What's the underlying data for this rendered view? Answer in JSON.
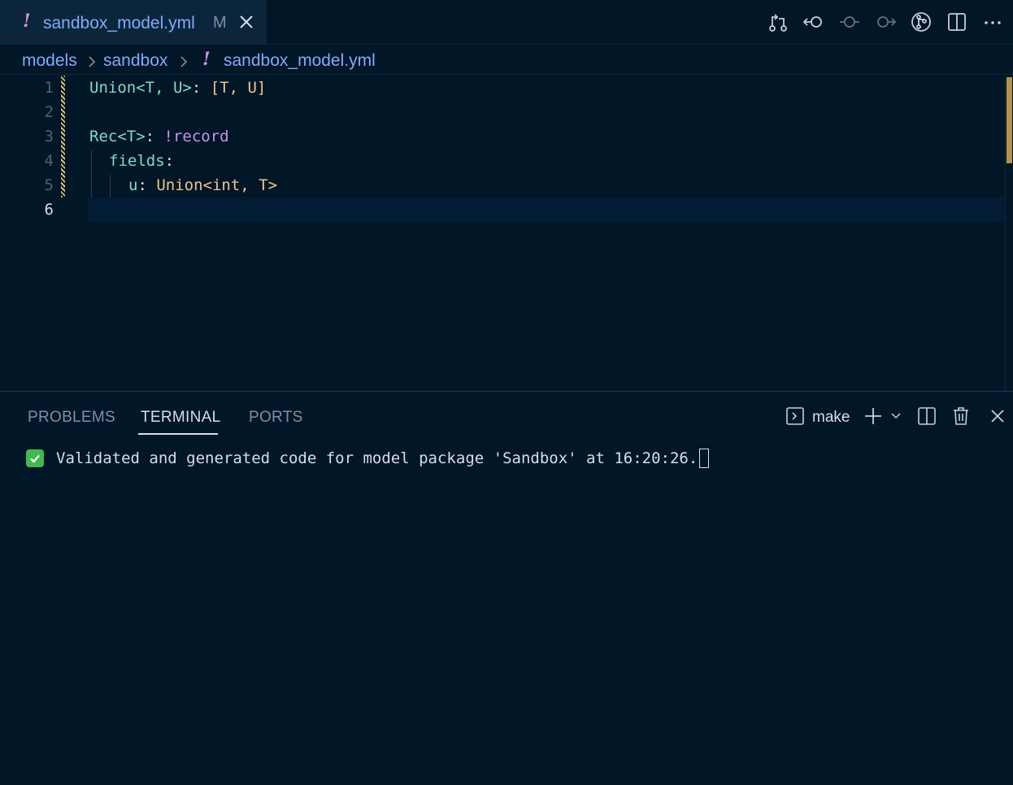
{
  "tab": {
    "icon_glyph": "!",
    "filename": "sandbox_model.yml",
    "modified_badge": "M"
  },
  "toolbar": {
    "icons": [
      "open-changes-icon",
      "previous-change-icon",
      "commit-icon",
      "next-change-icon",
      "git-graph-icon",
      "split-editor-icon",
      "more-actions-icon"
    ]
  },
  "breadcrumb": {
    "items": [
      "models",
      "sandbox",
      "sandbox_model.yml"
    ],
    "file_glyph": "!"
  },
  "editor": {
    "line_numbers": [
      "1",
      "2",
      "3",
      "4",
      "5",
      "6"
    ],
    "active_line": 6,
    "lines": [
      {
        "t1": "Union<T, U>",
        "t2": ":",
        "t3": " [T, U]"
      },
      {},
      {
        "t1": "Rec<T>",
        "t2": ":",
        "t3": " !record"
      },
      {
        "t1": "fields",
        "t2": ":"
      },
      {
        "t1": "u",
        "t2": ":",
        "t3": " Union<int, T>"
      },
      {}
    ]
  },
  "panel": {
    "tabs": [
      "PROBLEMS",
      "TERMINAL",
      "PORTS"
    ],
    "active_tab": "TERMINAL",
    "terminal_name": "make",
    "terminal_output": "Validated and generated code for model package 'Sandbox' at 16:20:26."
  },
  "colors": {
    "background": "#011627",
    "accent": "#82aaff",
    "keyword": "#7fdbca",
    "string": "#ecc48d",
    "tag": "#c792ea",
    "modified_gutter": "#d9c06a",
    "success": "#3fb950"
  }
}
